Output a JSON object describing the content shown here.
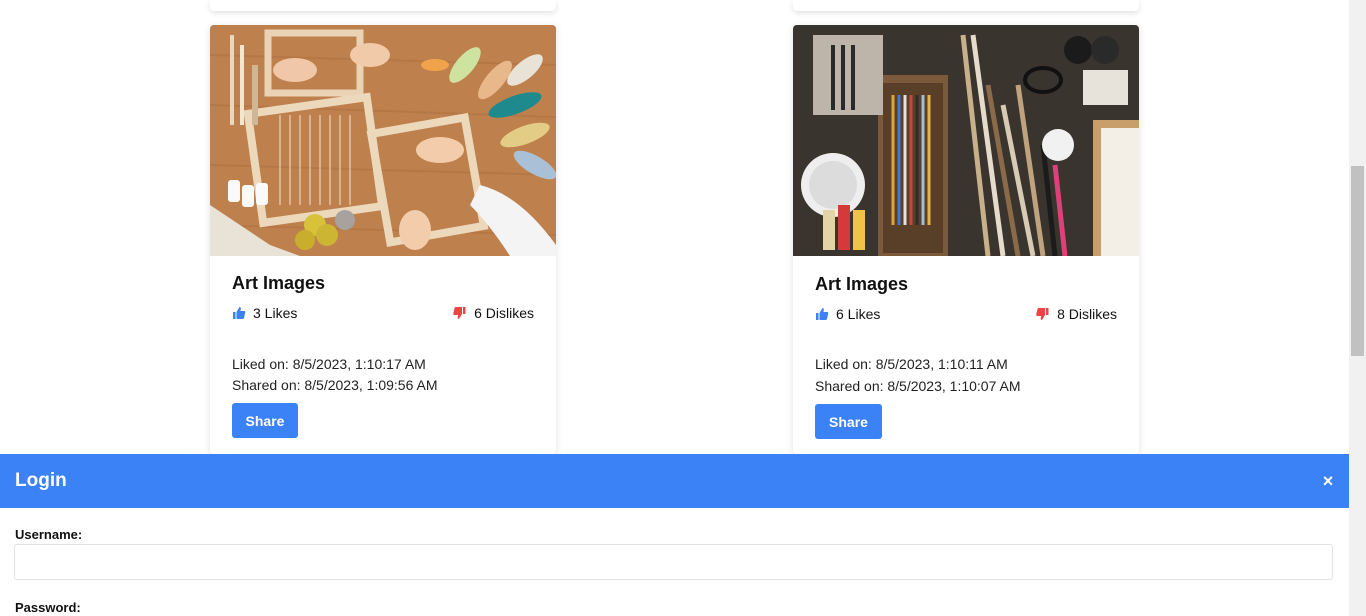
{
  "cards": [
    {
      "title": "Art Images",
      "likes": "3 Likes",
      "dislikes": "6 Dislikes",
      "liked_on": "Liked on: 8/5/2023, 1:10:17 AM",
      "shared_on": "Shared on: 8/5/2023, 1:09:56 AM",
      "share_label": "Share",
      "image_subject": "weaving looms and yarn on wooden table"
    },
    {
      "title": "Art Images",
      "likes": "6 Likes",
      "dislikes": "8 Dislikes",
      "liked_on": "Liked on: 8/5/2023, 1:10:11 AM",
      "shared_on": "Shared on: 8/5/2023, 1:10:07 AM",
      "share_label": "Share",
      "image_subject": "art supplies: brushes, pencils and paints"
    }
  ],
  "login": {
    "title": "Login",
    "close_label": "×",
    "username_label": "Username:",
    "username_value": "",
    "password_label": "Password:"
  },
  "colors": {
    "accent": "#3b82f6",
    "like_icon": "#3b82f6",
    "dislike_icon": "#ef4444"
  },
  "icons": {
    "like": "thumbs-up-icon",
    "dislike": "thumbs-down-icon",
    "close": "close-icon"
  }
}
